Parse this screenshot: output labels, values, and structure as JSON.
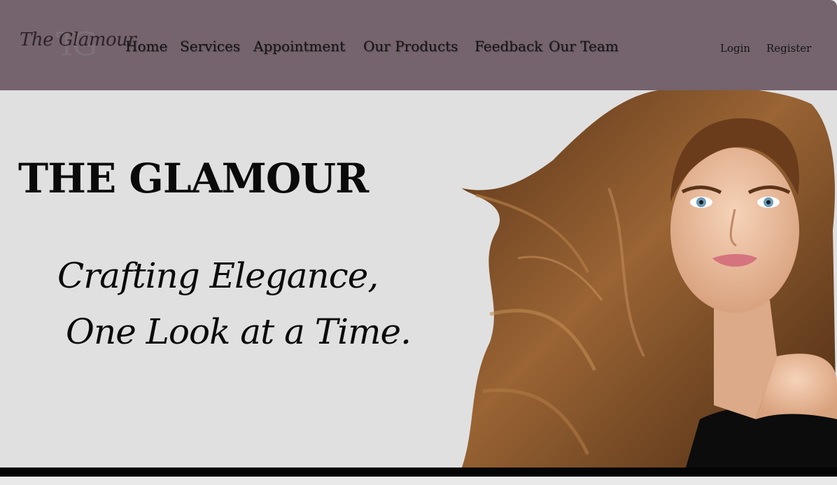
{
  "nav": {
    "logo_text": "The Glamour",
    "logo_monogram": "TG",
    "links": [
      {
        "label": "Home"
      },
      {
        "label": "Services"
      },
      {
        "label": "Appointment"
      },
      {
        "label": "Our Products"
      },
      {
        "label": "Feedback"
      },
      {
        "label": "Our Team"
      }
    ],
    "login_label": "Login",
    "register_label": "Register",
    "bg_color": "#75636d"
  },
  "hero": {
    "title": "THE GLAMOUR",
    "tagline_line1": "Crafting Elegance,",
    "tagline_line2": "One Look at a Time.",
    "bg_color": "#e0e0e0"
  }
}
